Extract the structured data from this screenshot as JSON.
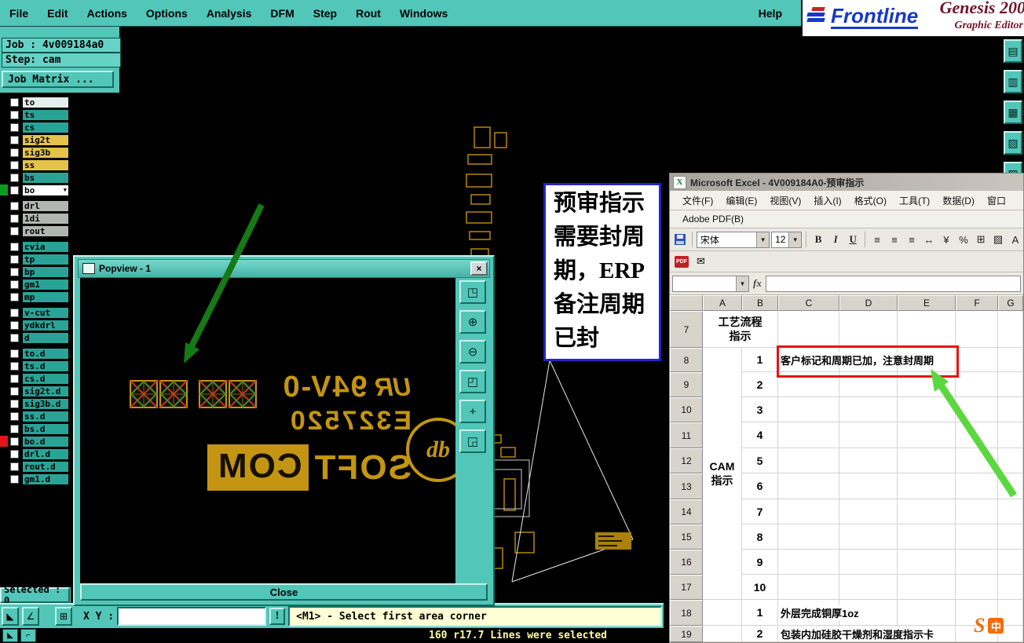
{
  "colors": {
    "teal": "#52c6b9",
    "teal_hi": "#c8f2ea",
    "teal_lo": "#156b60",
    "layer_teal": "#2aa397",
    "layer_gold": "#e3c34b",
    "layer_gray": "#b2b6b2",
    "layer_light": "#e4efec",
    "gold": "#c39512",
    "annotation_border": "#2424cc",
    "highlight_red": "#ea1212",
    "arrow_dark_green": "#157a15",
    "arrow_light_green": "#5ad83e",
    "statusbar_yellow": "#ffffd6",
    "console_text": "#ffff9c"
  },
  "menubar": {
    "items": [
      "File",
      "Edit",
      "Actions",
      "Options",
      "Analysis",
      "DFM",
      "Step",
      "Rout",
      "Windows"
    ],
    "help": "Help"
  },
  "brand": {
    "name": "Frontline",
    "product": "Genesis 200",
    "subtitle": "Graphic Editor"
  },
  "job_panel": {
    "job": "Job : 4v009184a0",
    "step": "Step: cam",
    "matrix": "Job Matrix ..."
  },
  "layer_groups": [
    {
      "rows": [
        {
          "name": "to",
          "style": "light"
        },
        {
          "name": "ts",
          "style": "teal"
        },
        {
          "name": "cs",
          "style": "teal"
        },
        {
          "name": "sig2t",
          "style": "gold"
        },
        {
          "name": "sig3b",
          "style": "gold"
        },
        {
          "name": "ss",
          "style": "gold"
        },
        {
          "name": "bs",
          "style": "teal"
        },
        {
          "name": "bo",
          "style": "white",
          "dropdown": true,
          "mark": "green"
        }
      ]
    },
    {
      "rows": [
        {
          "name": "drl",
          "style": "gray"
        },
        {
          "name": "1di",
          "style": "gray"
        },
        {
          "name": "rout",
          "style": "gray"
        }
      ]
    },
    {
      "rows": [
        {
          "name": "cvia",
          "style": "teal"
        },
        {
          "name": "tp",
          "style": "teal"
        },
        {
          "name": "bp",
          "style": "teal"
        },
        {
          "name": "gm1",
          "style": "teal"
        },
        {
          "name": "mp",
          "style": "teal"
        }
      ]
    },
    {
      "rows": [
        {
          "name": "v-cut",
          "style": "teal"
        },
        {
          "name": "ydkdrl",
          "style": "teal"
        },
        {
          "name": "d",
          "style": "teal"
        }
      ]
    },
    {
      "rows": [
        {
          "name": "to.d",
          "style": "teal"
        },
        {
          "name": "ts.d",
          "style": "teal"
        },
        {
          "name": "cs.d",
          "style": "teal"
        },
        {
          "name": "sig2t.d",
          "style": "teal"
        },
        {
          "name": "sig3b.d",
          "style": "teal"
        },
        {
          "name": "ss.d",
          "style": "teal"
        },
        {
          "name": "bs.d",
          "style": "teal"
        },
        {
          "name": "bo.d",
          "style": "teal",
          "mark": "red"
        },
        {
          "name": "drl.d",
          "style": "teal"
        },
        {
          "name": "rout.d",
          "style": "teal"
        },
        {
          "name": "gm1.d",
          "style": "teal"
        }
      ]
    }
  ],
  "selected_label": "Selected : 0",
  "statusbar": {
    "xy_label": "X Y :",
    "alert": "!",
    "message": "<M1> - Select first area corner",
    "tools": [
      {
        "name": "select-pointer-icon",
        "glyph": "◣"
      },
      {
        "name": "angle-measure-icon",
        "glyph": "∠"
      },
      {
        "name": "grid-toggle-icon",
        "glyph": "⊞"
      }
    ]
  },
  "console": {
    "tail": "160 r17.7 Lines were selected",
    "tools": [
      {
        "name": "corner-resize-icon",
        "glyph": "◣"
      },
      {
        "name": "prompt-icon",
        "glyph": "⌐"
      }
    ]
  },
  "side_tools": [
    {
      "name": "copy-view-icon",
      "glyph": "▤"
    },
    {
      "name": "screen-capture-icon",
      "glyph": "▥"
    },
    {
      "name": "overlay-view-icon",
      "glyph": "▦"
    },
    {
      "name": "print-view-icon",
      "glyph": "▧"
    },
    {
      "name": "notes-icon",
      "glyph": "▨"
    }
  ],
  "popview": {
    "title": "Popview - 1",
    "close_button": "Close",
    "tools": [
      {
        "name": "zoom-window-button",
        "glyph": "◳"
      },
      {
        "name": "zoom-in-button",
        "glyph": "⊕"
      },
      {
        "name": "zoom-out-button",
        "glyph": "⊖"
      },
      {
        "name": "zoom-fit-button",
        "glyph": "◰"
      },
      {
        "name": "pan-button",
        "glyph": "+"
      },
      {
        "name": "home-view-button",
        "glyph": "◲"
      }
    ],
    "artwork": {
      "ul_mark": "UR",
      "flam_class": "94V-0",
      "code": "E327520",
      "brand_solid": "SOFT",
      "brand_boxed": "COM",
      "circle_mark": "db"
    }
  },
  "annotation": {
    "lines": [
      "预审指示",
      "需要封周",
      "期，ERP",
      "备注周期",
      "已封"
    ]
  },
  "excel": {
    "title": "Microsoft Excel - 4V009184A0-预审指示",
    "window_icon": "X",
    "menu": [
      "文件(F)",
      "编辑(E)",
      "视图(V)",
      "插入(I)",
      "格式(O)",
      "工具(T)",
      "数据(D)",
      "窗口"
    ],
    "menu2": "Adobe PDF(B)",
    "toolbar": {
      "font": "宋体",
      "size": "12",
      "bold": "B",
      "italic": "I",
      "underline": "U"
    },
    "toolbar_icons": [
      {
        "name": "align-left-icon",
        "glyph": "≡"
      },
      {
        "name": "align-center-icon",
        "glyph": "≡"
      },
      {
        "name": "align-right-icon",
        "glyph": "≡"
      },
      {
        "name": "merge-center-icon",
        "glyph": "↔"
      },
      {
        "name": "currency-icon",
        "glyph": "¥"
      },
      {
        "name": "percent-icon",
        "glyph": "%"
      },
      {
        "name": "border-icon",
        "glyph": "⊞"
      },
      {
        "name": "fill-color-icon",
        "glyph": "▨"
      },
      {
        "name": "font-color-icon",
        "glyph": "A"
      }
    ],
    "pdf_toolbar": [
      {
        "name": "pdf-export-icon",
        "glyph": "PDF"
      },
      {
        "name": "pdf-mail-icon",
        "glyph": "✉"
      }
    ],
    "formula_fx": "fx",
    "columns": [
      "A",
      "B",
      "C",
      "D",
      "E",
      "F",
      "G"
    ],
    "section1_header": "工艺流程指示",
    "section2_header": "CAM指示",
    "rows": [
      {
        "num": "7"
      },
      {
        "num": "8",
        "seq": "1",
        "text": "客户标记和周期已加，注意封周期",
        "highlight": true
      },
      {
        "num": "9",
        "seq": "2"
      },
      {
        "num": "10",
        "seq": "3"
      },
      {
        "num": "11",
        "seq": "4"
      },
      {
        "num": "12",
        "seq": "5"
      },
      {
        "num": "13",
        "seq": "6"
      },
      {
        "num": "14",
        "seq": "7"
      },
      {
        "num": "15",
        "seq": "8"
      },
      {
        "num": "16",
        "seq": "9"
      },
      {
        "num": "17",
        "seq": "10"
      },
      {
        "num": "18",
        "seq": "1",
        "text": "外层完成铜厚1oz"
      },
      {
        "num": "19",
        "seq": "2",
        "text": "包装内加硅胶干燥剂和湿度指示卡"
      }
    ]
  },
  "icons": {
    "close": "×",
    "dropdown": "▼"
  },
  "ime": {
    "logo": "S",
    "lang": "中"
  }
}
